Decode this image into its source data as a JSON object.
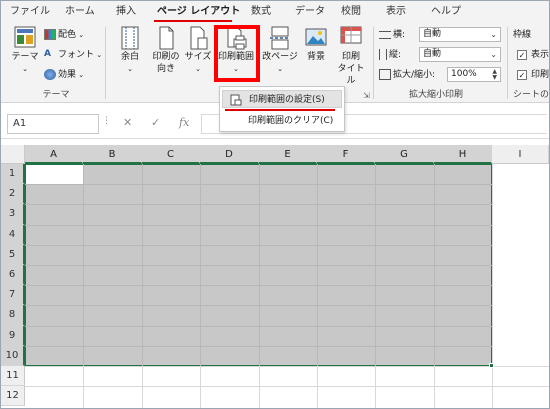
{
  "ribbon_tabs": [
    "ファイル",
    "ホーム",
    "挿入",
    "ページ レイアウト",
    "数式",
    "データ",
    "校閲",
    "表示",
    "ヘルプ"
  ],
  "active_tab": "ページ レイアウト",
  "accent_colors": {
    "highlight": "#ff0000",
    "selection_border": "#217346",
    "selection_fill": "#c8c8c8"
  },
  "ribbon": {
    "theme_group": {
      "label": "テーマ",
      "theme_button": "テーマ",
      "colors": "配色",
      "fonts": "フォント",
      "effects": "効果"
    },
    "page_setup": {
      "margins": "余白",
      "orientation_1": "印刷の",
      "orientation_2": "向き",
      "size": "サイズ",
      "print_area": "印刷範囲",
      "breaks": "改ページ",
      "background": "背景",
      "print_titles_1": "印刷",
      "print_titles_2": "タイトル"
    },
    "scale_group": {
      "label": "拡大縮小印刷",
      "width_label": "横:",
      "width_value": "自動",
      "height_label": "縦:",
      "height_value": "自動",
      "scale_label": "拡大/縮小:",
      "scale_value": "100%"
    },
    "sheet_options": {
      "label": "シートの",
      "gridlines": "枠線",
      "view": "表示",
      "print": "印刷"
    }
  },
  "print_area_menu": [
    {
      "label": "印刷範囲の設定(S)",
      "highlighted": true
    },
    {
      "label": "印刷範囲のクリア(C)",
      "highlighted": false
    }
  ],
  "formula_bar": {
    "name_box": "A1",
    "cancel": "✕",
    "enter": "✓",
    "fx": "fx",
    "value": ""
  },
  "columns": [
    "A",
    "B",
    "C",
    "D",
    "E",
    "F",
    "G",
    "H",
    "I"
  ],
  "rows": [
    "1",
    "2",
    "3",
    "4",
    "5",
    "6",
    "7",
    "8",
    "9",
    "10",
    "11",
    "12"
  ],
  "selected_range": "A1:H10"
}
